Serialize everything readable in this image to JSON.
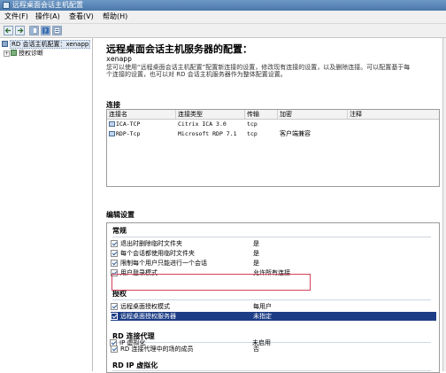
{
  "window": {
    "title": "远程桌面会话主机配置"
  },
  "menu": [
    {
      "label": "文件(F)"
    },
    {
      "label": "操作(A)"
    },
    {
      "label": "查看(V)"
    },
    {
      "label": "帮助(H)"
    }
  ],
  "toolbar": {
    "buttons": [
      {
        "icon": "back-arrow-icon"
      },
      {
        "icon": "forward-arrow-icon"
      },
      {
        "icon": "console-tree-icon"
      },
      {
        "icon": "help-icon"
      },
      {
        "icon": "properties-icon"
      }
    ]
  },
  "tree": {
    "root": {
      "label": "RD 会话主机配置：xenapp"
    },
    "child": {
      "label": "授权诊断"
    }
  },
  "main": {
    "heading": "远程桌面会话主机服务器的配置：",
    "server": "xenapp",
    "desc_line1": "您可以使用“远程桌面会话主机配置”配置新连接的设置，修改现有连接的设置，以及删除连接。可以配置基于每",
    "desc_line2": "个连接的设置，也可以对 RD 会话主机服务器作为整体配置设置。"
  },
  "connections": {
    "section_label": "连接",
    "columns": [
      "连接名",
      "连接类型",
      "传输",
      "加密",
      "注释"
    ],
    "rows": [
      {
        "name": "ICA-TCP",
        "type": "Citrix ICA 3.0",
        "transport": "tcp",
        "encryption": "",
        "comment": ""
      },
      {
        "name": "RDP-Tcp",
        "type": "Microsoft RDP 7.1",
        "transport": "tcp",
        "encryption": "客户端兼容",
        "comment": ""
      }
    ]
  },
  "edit_settings": {
    "section_label": "编辑设置",
    "groups": {
      "general": {
        "title": "常规",
        "items": [
          {
            "name": "退出时删除临时文件夹",
            "value": "是"
          },
          {
            "name": "每个会话都使用临时文件夹",
            "value": "是"
          },
          {
            "name": "限制每个用户只能进行一个会话",
            "value": "是"
          },
          {
            "name": "用户登录模式",
            "value": "允许所有连接"
          }
        ]
      },
      "licensing": {
        "title": "授权",
        "items": [
          {
            "name": "远程桌面授权模式",
            "value": "每用户"
          },
          {
            "name": "远程桌面授权服务器",
            "value": "未指定"
          }
        ]
      },
      "broker": {
        "title": "RD 连接代理",
        "items": [
          {
            "name": "RD 连接代理中的场的成员",
            "value": "否"
          }
        ]
      },
      "ipvirt": {
        "title": "RD IP 虚拟化",
        "items": [
          {
            "name": "IP 虚拟化",
            "value": "未启用"
          }
        ]
      }
    }
  },
  "colors": {
    "selection": "#1d3e86",
    "highlight_box": "#d4415a",
    "titlebar": "#4a78ab"
  }
}
